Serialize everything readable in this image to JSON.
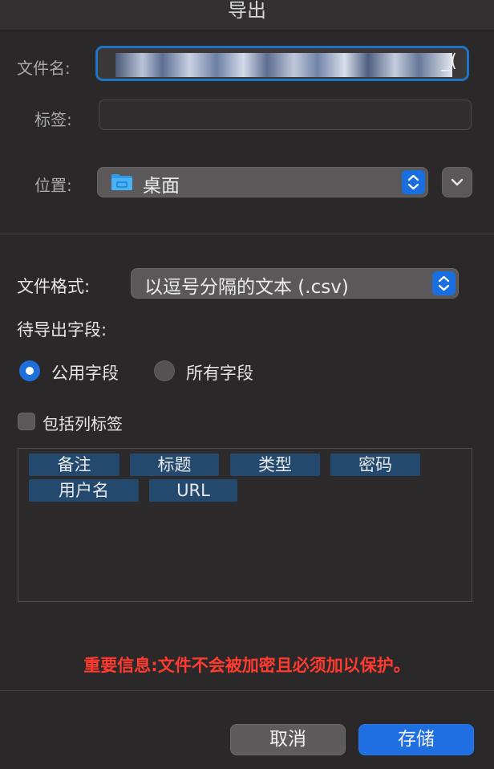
{
  "dialog": {
    "title": "导出"
  },
  "filename": {
    "label": "文件名:",
    "value_visible": "_("
  },
  "tags": {
    "label": "标签:",
    "value": ""
  },
  "location": {
    "label": "位置:",
    "value": "桌面",
    "folder_icon": "folder-icon",
    "expand_icon": "chevron-down-icon"
  },
  "format": {
    "label": "文件格式:",
    "value": "以逗号分隔的文本 (.csv)"
  },
  "fields": {
    "label": "待导出字段:",
    "options": [
      {
        "label": "公用字段",
        "selected": true
      },
      {
        "label": "所有字段",
        "selected": false
      }
    ],
    "include_headers": {
      "label": "包括列标签",
      "checked": false
    },
    "list": [
      "备注",
      "标题",
      "类型",
      "密码",
      "用户名",
      "URL"
    ]
  },
  "warning": "重要信息:文件不会被加密且必须加以保护。",
  "buttons": {
    "cancel": "取消",
    "save": "存储"
  },
  "colors": {
    "accent": "#1f6fe3",
    "warning": "#ff3b30",
    "chip": "#24496f"
  }
}
